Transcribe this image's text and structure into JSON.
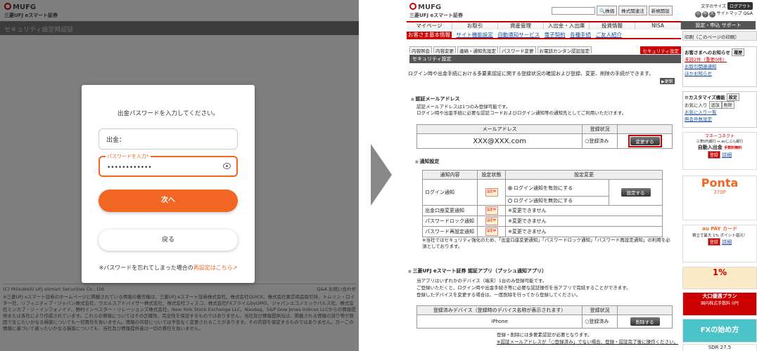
{
  "left": {
    "brand": "MUFG",
    "brand_sub": "三菱UFJ eスマート証券",
    "page_title": "セキュリティ設定時認証",
    "footer_copy": "(C) Mitsubishi UFJ eSmart Securities Co., Ltd.",
    "footer_links": "Q&A お問い合わせ",
    "footer_text": "※三菱UFJ eスマート証券のホームページに掲載されている情報の著作権は、三菱UFJ eスマート証券株式会社、株式会社QUICK、株式会社東京商品取引所、トムソン・ロイター社、リフィニティブ・ジャパン株式会社、ウエルスアドバイザー株式会社、株式会社フィスコ、株式会社FXプライムbyGMO、ジャパンエコノミックパルス社、株式会社ミンカブ・ジ・インフォノイド、野村インベスター・リレーションズ株式会社、New York Stock Exchange LLC、Nasdaq、S&P Dow Jones Indices LLCからの情報提供または各社により作成されています。これらの情報についてはその正確性、完全性を保証するものではありません。当社及び情報提供元は、掲載される情報の誤り等が原因で生じたいかなる損害についても一切責任を負いません。情報の内容については予告なく変更されることがあります。その内容を保証するものではありません。万一この情報に基づいて被ったいかなる損害についても、当社及び情報提供者は一切の責任を負いません。"
  },
  "modal": {
    "prompt": "出金パスワードを入力してください。",
    "amount_label": "出金：",
    "password_label": "パスワードを入力*",
    "password_value": "••••••••••••",
    "next_button": "次へ",
    "back_button": "戻る",
    "forgot_text": "※パスワードを忘れてしまった場合の",
    "forgot_link": "再設定はこちら"
  },
  "right": {
    "brand": "MUFG",
    "brand_sub": "三菱UFJ eスマート証券",
    "search_buttons": [
      "株価",
      "株式関連法",
      "新規開設"
    ],
    "font_size_label": "文字のサイズ",
    "font_sizes": [
      "小",
      "中",
      "大"
    ],
    "logout": "ログアウト",
    "top_links": "サイトマップ  Q&A",
    "gnav": [
      "マイページ",
      "お取引",
      "資産管理",
      "入出金・入出庫",
      "投資情報",
      "NISA"
    ],
    "gnav_right": "設定・申込  サポート",
    "subnav": [
      "お客さま基本情報",
      "サイト機能設定",
      "自動通知サービス",
      "電子契約",
      "各種手続",
      "ご友人紹介"
    ],
    "tabs": [
      "内容照会",
      "内容変更",
      "連絡・通知先設定",
      "パスワード変更",
      "お電話カンタン認証設定"
    ],
    "active_tab": "セキュリティ設定",
    "section_title": "セキュリティ設定",
    "description": "ログイン時や出金手続における多要素認証に関する登録状況の確認および登録、変更、削除の手続ができます。",
    "update_label": "更新",
    "auth_email": {
      "heading": "認証メールアドレス",
      "line1": "認証メールアドレスは1つのみ登録可能です。",
      "line2": "ログイン時や出金手続に必要な認証コードおよびログイン通知等の通知先としてご利用いただけます。",
      "col_email": "メールアドレス",
      "col_status": "登録状況",
      "email": "XXX@XXX.com",
      "status": "○登録済み",
      "change_button": "変更する"
    },
    "notify": {
      "heading": "通知設定",
      "cols": [
        "通知内容",
        "設定状態",
        "設定変更"
      ],
      "rows": [
        {
          "name": "ログイン通知",
          "opt1": "ログイン通知を有効にする",
          "opt2": "ログイン通知を無効にする"
        },
        {
          "name": "出金口座変更通知",
          "note": "※変更できません"
        },
        {
          "name": "パスワードロック通知",
          "note": "※変更できません"
        },
        {
          "name": "パスワード再設定通知",
          "note": "※変更できません"
        }
      ],
      "badge": "設定中",
      "set_button": "設定する",
      "footnote1": "※当社ではセキュリティ強化のため、「出金口座変更通知」「パスワードロック通知」「パスワード再設定通知」の利用を必",
      "footnote2": "須としております。"
    },
    "app": {
      "heading": "三菱UFJ eスマート証券 認証アプリ（プッシュ通知アプリ）",
      "line1": "当アプリはいずれかのデバイス（端末）1台のみ登録可能です。",
      "line2": "ご登録いただくと、ログイン時や出金手続き等に必要な認証操作を当アプリで完結することができます。",
      "line3": "登録したデバイスを変更する場合は、一度削除を行ってから登録してください。",
      "col_device": "登録済みデバイス（登録時のデバイス名称が表示されます）",
      "col_status": "登録状況",
      "device": "iPhone",
      "status": "○登録済み",
      "delete_button": "削除する",
      "note1": "登録・削除には多要素認証が必要となります。",
      "note2": "※認証メールアドレスが「○登録済み」でない場合、登録・認証完了後に操作ください。"
    },
    "side": {
      "print": "印刷（このページの印刷）",
      "notice_title": "お客さまへのお知らせ",
      "notice_pill": "履歴",
      "notice_items": [
        "未読2件（重要0件）",
        "お取引関連通知",
        "ほかお知らせ"
      ],
      "custom_title": "カスタマイズ機能",
      "custom_pill": "設定",
      "fav": "お気に入り",
      "fav_pills": [
        "追加",
        "削除"
      ],
      "fav_items": [
        "お気に入り一覧",
        "照会件数設定"
      ],
      "money_connect": "マネーコネクト",
      "money_sub": "三菱UFJ銀行 ⇔ auじぶん銀行",
      "auto_deposit": "自動入出金",
      "fee": "手数料無料",
      "register": "登録",
      "details": "詳細",
      "ponta": "Ponta",
      "ponta_pts": "370P",
      "aupay": "au PAY カード",
      "aupay_sub": "積立で最大 1% ポイント還元！",
      "campaign1": "1%",
      "big": "大口優遇プラン",
      "big_sub": "国内株式手数料 0円",
      "fx": "FXの始め方",
      "sdr": "SDR 27.5"
    }
  }
}
